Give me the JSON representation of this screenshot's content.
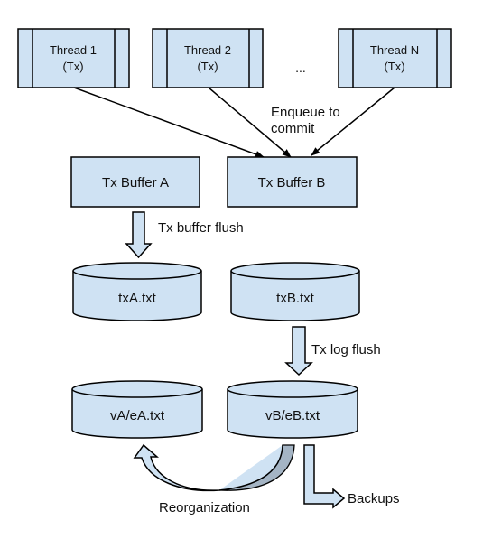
{
  "threads": [
    {
      "name": "Thread 1",
      "sub": "(Tx)"
    },
    {
      "name": "Thread 2",
      "sub": "(Tx)"
    },
    {
      "name": "Thread N",
      "sub": "(Tx)"
    }
  ],
  "ellipsis": "...",
  "enqueue_label": {
    "line1": "Enqueue to",
    "line2": "commit"
  },
  "buffers": {
    "a": "Tx Buffer A",
    "b": "Tx Buffer B"
  },
  "buffer_flush_label": "Tx buffer flush",
  "tx_files": {
    "a": "txA.txt",
    "b": "txB.txt"
  },
  "log_flush_label": "Tx log flush",
  "data_files": {
    "a": "vA/eA.txt",
    "b": "vB/eB.txt"
  },
  "reorganization_label": "Reorganization",
  "backups_label": "Backups",
  "colors": {
    "fill": "#cfe2f3",
    "stroke": "#000000",
    "shadow": "#a4b4c4"
  }
}
